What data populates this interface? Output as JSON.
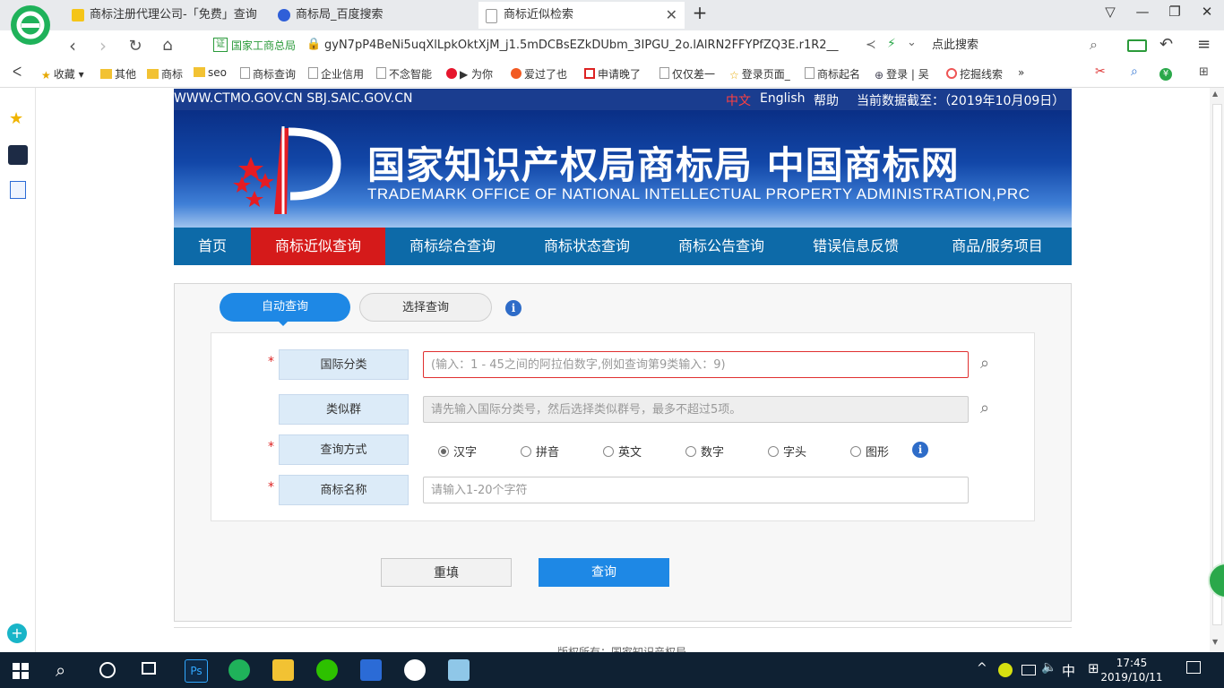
{
  "browser": {
    "tabs": [
      {
        "title": "商标注册代理公司-「免费」查询",
        "active": false
      },
      {
        "title": "商标局_百度搜索",
        "active": false
      },
      {
        "title": "商标近似检索",
        "active": true
      }
    ],
    "url_badge": "国家工商总局",
    "url": "gyN7pP4BeNi5uqXlLpkOktXjM_j1.5mDCBsEZkDUbm_3IPGU_2o.lAlRN2FFYPfZQ3E.r1R2__",
    "search_placeholder": "点此搜索",
    "bookmarks": [
      "收藏",
      "其他",
      "商标",
      "seo",
      "商标查询",
      "企业信用",
      "不念智能",
      "▶ 为你",
      "爱过了也",
      "申请晚了",
      "仅仅差一",
      "登录页面_",
      "商标起名",
      "登录 | 吴",
      "挖掘线索",
      "»"
    ]
  },
  "site": {
    "domains": "WWW.CTMO.GOV.CN SBJ.SAIC.GOV.CN",
    "lang_zh": "中文",
    "lang_en": "English",
    "help": "帮助",
    "data_date": "当前数据截至：（2019年10月09日）",
    "title_cn": "国家知识产权局商标局 中国商标网",
    "title_en": "TRADEMARK OFFICE OF NATIONAL INTELLECTUAL PROPERTY ADMINISTRATION,PRC",
    "nav": [
      "首页",
      "商标近似查询",
      "商标综合查询",
      "商标状态查询",
      "商标公告查询",
      "错误信息反馈",
      "商品/服务项目"
    ]
  },
  "form": {
    "tab_auto": "自动查询",
    "tab_select": "选择查询",
    "required_mark": "*",
    "class_label": "国际分类",
    "class_placeholder": "(输入：1 - 45之间的阿拉伯数字,例如查询第9类输入：9)",
    "group_label": "类似群",
    "group_placeholder": "请先输入国际分类号，然后选择类似群号，最多不超过5项。",
    "mode_label": "查询方式",
    "modes": [
      "汉字",
      "拼音",
      "英文",
      "数字",
      "字头",
      "图形"
    ],
    "name_label": "商标名称",
    "name_placeholder": "请输入1-20个字符",
    "reset": "重填",
    "submit": "查询"
  },
  "footer_partial": "版权所有：国家知识产权局",
  "taskbar": {
    "ime": "中",
    "time": "17:45",
    "date": "2019/10/11"
  },
  "colors": {
    "nav_bg": "#0d6aa8",
    "nav_active": "#d51a1a",
    "primary_button": "#1e88e5",
    "top_strip": "#1a3d8f"
  }
}
